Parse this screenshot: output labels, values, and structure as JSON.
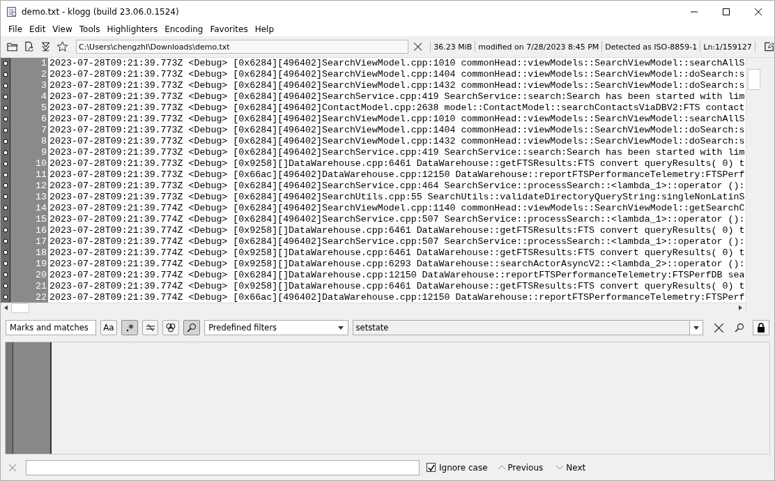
{
  "window": {
    "title": "demo.txt - klogg (build 23.06.0.1524)"
  },
  "menu": [
    "File",
    "Edit",
    "View",
    "Tools",
    "Highlighters",
    "Encoding",
    "Favorites",
    "Help"
  ],
  "toolbar": {
    "path": "C:\\Users\\chengzhl\\Downloads\\demo.txt",
    "status": [
      "36.23 MiB",
      "modified on 7/28/2023 8:45 PM",
      "Detected as ISO-8859-1",
      "Ln:1/159127"
    ]
  },
  "log": [
    {
      "number": "1",
      "text": "2023-07-28T09:21:39.773Z <Debug> [0x6284][496402]SearchViewModel.cpp:1010 commonHead::viewModels::SearchViewModel::searchAllS"
    },
    {
      "number": "2",
      "text": "2023-07-28T09:21:39.773Z <Debug> [0x6284][496402]SearchViewModel.cpp:1404 commonHead::viewModels::SearchViewModel::doSearch:s"
    },
    {
      "number": "3",
      "text": "2023-07-28T09:21:39.773Z <Debug> [0x6284][496402]SearchViewModel.cpp:1432 commonHead::viewModels::SearchViewModel::doSearch:s"
    },
    {
      "number": "4",
      "text": "2023-07-28T09:21:39.773Z <Debug> [0x6284][496402]SearchService.cpp:419 SearchService::search:Search has been started with lim"
    },
    {
      "number": "5",
      "text": "2023-07-28T09:21:39.773Z <Debug> [0x6284][496402]ContactModel.cpp:2638 model::ContactModel::searchContactsViaDBV2:FTS contact"
    },
    {
      "number": "6",
      "text": "2023-07-28T09:21:39.773Z <Debug> [0x6284][496402]SearchViewModel.cpp:1010 commonHead::viewModels::SearchViewModel::searchAllS"
    },
    {
      "number": "7",
      "text": "2023-07-28T09:21:39.773Z <Debug> [0x6284][496402]SearchViewModel.cpp:1404 commonHead::viewModels::SearchViewModel::doSearch:s"
    },
    {
      "number": "8",
      "text": "2023-07-28T09:21:39.773Z <Debug> [0x6284][496402]SearchViewModel.cpp:1432 commonHead::viewModels::SearchViewModel::doSearch:s"
    },
    {
      "number": "9",
      "text": "2023-07-28T09:21:39.773Z <Debug> [0x6284][496402]SearchService.cpp:419 SearchService::search:Search has been started with lim"
    },
    {
      "number": "10",
      "text": "2023-07-28T09:21:39.773Z <Debug> [0x9258][]DataWarehouse.cpp:6461 DataWarehouse::getFTSResults:FTS convert queryResults( 0) t"
    },
    {
      "number": "11",
      "text": "2023-07-28T09:21:39.773Z <Debug> [0x66ac][496402]DataWarehouse.cpp:12150 DataWarehouse::reportFTSPerformanceTelemetry:FTSPerf"
    },
    {
      "number": "12",
      "text": "2023-07-28T09:21:39.773Z <Debug> [0x6284][496402]SearchService.cpp:464 SearchService::processSearch::<lambda_1>::operator ():"
    },
    {
      "number": "13",
      "text": "2023-07-28T09:21:39.773Z <Debug> [0x6284][496402]SearchUtils.cpp:55 SearchUtils::validateDirectoryQueryString:singleNonLatinS"
    },
    {
      "number": "14",
      "text": "2023-07-28T09:21:39.774Z <Debug> [0x6284][496402]SearchViewModel.cpp:1140 commonHead::viewModels::SearchViewModel::getSearchC"
    },
    {
      "number": "15",
      "text": "2023-07-28T09:21:39.774Z <Debug> [0x6284][496402]SearchService.cpp:507 SearchService::processSearch::<lambda_1>::operator ():"
    },
    {
      "number": "16",
      "text": "2023-07-28T09:21:39.774Z <Debug> [0x9258][]DataWarehouse.cpp:6461 DataWarehouse::getFTSResults:FTS convert queryResults( 0) t"
    },
    {
      "number": "17",
      "text": "2023-07-28T09:21:39.774Z <Debug> [0x6284][496402]SearchService.cpp:507 SearchService::processSearch::<lambda_1>::operator ():"
    },
    {
      "number": "18",
      "text": "2023-07-28T09:21:39.774Z <Debug> [0x9258][]DataWarehouse.cpp:6461 DataWarehouse::getFTSResults:FTS convert queryResults( 0) t"
    },
    {
      "number": "19",
      "text": "2023-07-28T09:21:39.774Z <Debug> [0x9258][]DataWarehouse.cpp:6293 DataWarehouse::searchActorAsyncV2::<lambda_2>::operator ():"
    },
    {
      "number": "20",
      "text": "2023-07-28T09:21:39.774Z <Debug> [0x6284][]DataWarehouse.cpp:12150 DataWarehouse::reportFTSPerformanceTelemetry:FTSPerfDB sea"
    },
    {
      "number": "21",
      "text": "2023-07-28T09:21:39.774Z <Debug> [0x9258][]DataWarehouse.cpp:6461 DataWarehouse::getFTSResults:FTS convert queryResults( 0) t"
    },
    {
      "number": "22",
      "text": "2023-07-28T09:21:39.774Z <Debug> [0x66ac][496402]DataWarehouse.cpp:12150 DataWarehouse::reportFTSPerformanceTelemetry:FTSPerf"
    }
  ],
  "search_bar": {
    "mode": "Marks and matches",
    "toggles": [
      {
        "kind": "case",
        "label": "Aa",
        "selected": false
      },
      {
        "kind": "regex",
        "selected": true
      },
      {
        "kind": "inverse",
        "selected": false
      },
      {
        "kind": "combine",
        "selected": false
      },
      {
        "kind": "refresh",
        "selected": true
      }
    ],
    "filters": "Predefined filters",
    "value": "setstate"
  },
  "quick_find": {
    "ignore_case": {
      "label": "Ignore case",
      "checked": true
    },
    "previous": "Previous",
    "next": "Next"
  }
}
